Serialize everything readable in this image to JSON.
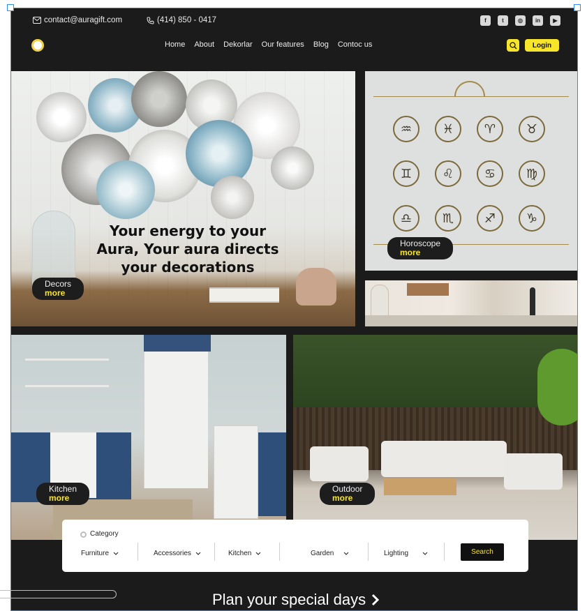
{
  "topbar": {
    "email": "contact@auragift.com",
    "phone": "(414) 850 - 0417",
    "socials": [
      {
        "icon": "facebook-icon",
        "glyph": "f"
      },
      {
        "icon": "twitter-icon",
        "glyph": "t"
      },
      {
        "icon": "instagram-icon",
        "glyph": "◎"
      },
      {
        "icon": "linkedin-icon",
        "glyph": "in"
      },
      {
        "icon": "youtube-icon",
        "glyph": "▶"
      }
    ]
  },
  "nav": {
    "items": [
      "Home",
      "About",
      "Dekorlar",
      "Our features",
      "Blog",
      "Contoc us"
    ],
    "login_label": "Login"
  },
  "tiles": {
    "hero": {
      "headline": "Your energy to your Aura, Your aura directs your decorations",
      "label": "Decors",
      "more": "more"
    },
    "horoscope": {
      "label": "Horoscope",
      "more": "more"
    },
    "kitchen": {
      "label": "Kitchen",
      "more": "more"
    },
    "outdoor": {
      "label": "Outdoor",
      "more": "more"
    }
  },
  "search_panel": {
    "category_label": "Category",
    "dropdowns": [
      "Furniture",
      "Accessories",
      "Kitchen",
      "Garden",
      "Lighting"
    ],
    "search_label": "Search"
  },
  "footer": {
    "plan_label": "Plan your special days"
  },
  "colors": {
    "accent": "#f6e52b",
    "background": "#1b1b1b",
    "selection": "#2f8cf3"
  }
}
